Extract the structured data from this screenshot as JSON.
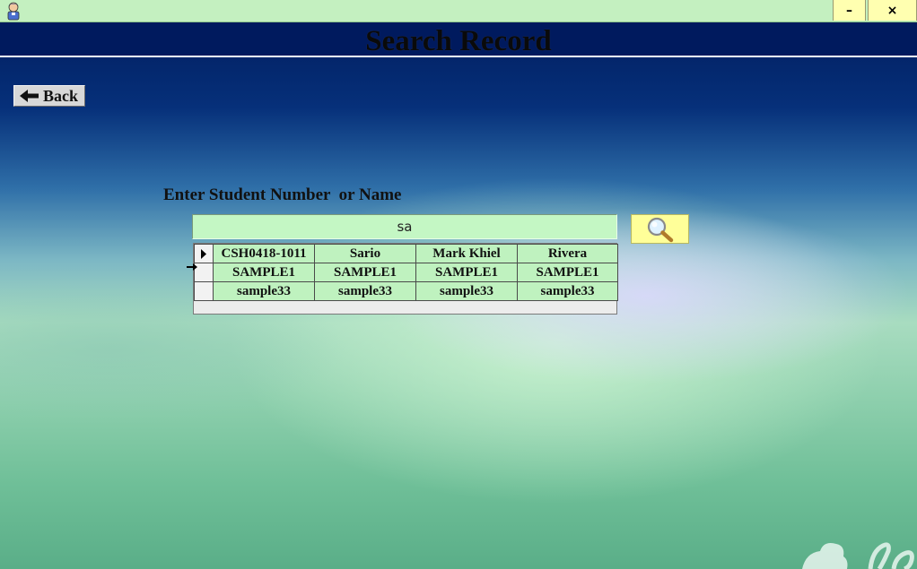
{
  "window": {
    "minimize_label": "–",
    "close_label": "×"
  },
  "header": {
    "title": "Search Record"
  },
  "back_button": {
    "label": "Back"
  },
  "search": {
    "prompt": "Enter Student Number  or Name",
    "value": "sa"
  },
  "results": {
    "rows": [
      {
        "cells": [
          "CSH0418-1011",
          "Sario",
          "Mark Khiel",
          "Rivera"
        ],
        "current": true
      },
      {
        "cells": [
          "SAMPLE1",
          "SAMPLE1",
          "SAMPLE1",
          "SAMPLE1"
        ],
        "current": false
      },
      {
        "cells": [
          "sample33",
          "sample33",
          "sample33",
          "sample33"
        ],
        "current": false
      }
    ]
  },
  "colors": {
    "titlebar": "#c4f0c0",
    "header": "#001a5e",
    "search_button": "#ffff99",
    "grid_cell": "#bff2bf"
  },
  "icons": {
    "back": "left-arrow-icon",
    "search": "magnifier-icon",
    "row_current": "row-pointer-icon",
    "app": "person-icon"
  }
}
